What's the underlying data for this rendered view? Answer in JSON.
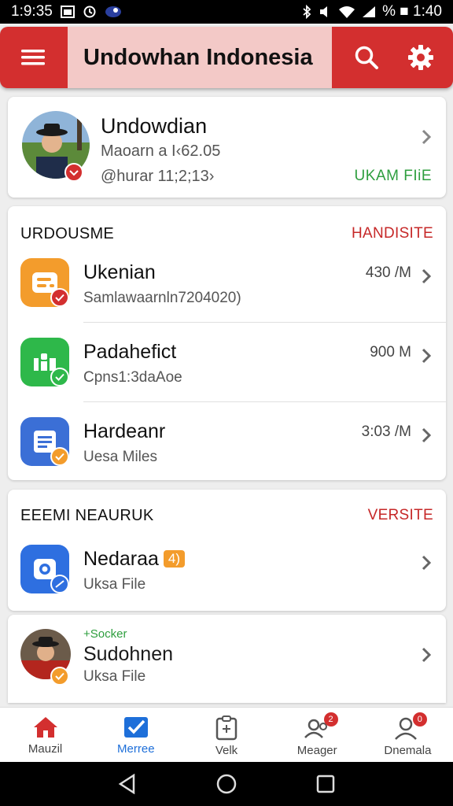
{
  "status_bar": {
    "time": "1:9:35",
    "right_text": "% ■ 1:40"
  },
  "app_bar": {
    "title": "Undowhan Indonesia"
  },
  "profile": {
    "name": "Undowdian",
    "line1": "Maoarn a I‹62.05",
    "line2": "@hurar 11;2;13›",
    "action": "UKAM FIiE"
  },
  "section1": {
    "heading": "URDOUSME",
    "link": "HANDISITE",
    "items": [
      {
        "title": "Ukenian",
        "subtitle": "Samlawaarnln7204020)",
        "size": "430 /M",
        "icon_color": "#f39c2c",
        "badge_color": "#d32f2f"
      },
      {
        "title": "Padahefict",
        "subtitle": "Cpns1:3daAoe",
        "size": "900 M",
        "icon_color": "#2eb84a",
        "badge_color": "#2eb84a"
      },
      {
        "title": "Hardeanr",
        "subtitle": "Uesa Miles",
        "size": "3:03 /M",
        "icon_color": "#3b6fd6",
        "badge_color": "#f39c2c"
      }
    ]
  },
  "section2": {
    "heading": "EEEMI NEAURUK",
    "link": "VERSITE",
    "items": [
      {
        "title": "Nedaraa",
        "tag": "4)",
        "subtitle": "Uksa File",
        "icon_color": "#2e6fe0",
        "badge_color": "#2e6fe0"
      }
    ]
  },
  "section3": {
    "label": "+Socker",
    "title": "Sudohnen",
    "subtitle": "Uksa File"
  },
  "bottom_nav": [
    {
      "label": "Mauzil",
      "icon": "home-icon",
      "color": "#d32f2f"
    },
    {
      "label": "Merree",
      "icon": "check-icon",
      "color": "#1e6fd9"
    },
    {
      "label": "Velk",
      "icon": "clipboard-icon",
      "color": "#555"
    },
    {
      "label": "Meager",
      "icon": "people-icon",
      "color": "#555",
      "badge": "2"
    },
    {
      "label": "Dnemala",
      "icon": "person-icon",
      "color": "#555",
      "badge": "0"
    }
  ],
  "colors": {
    "primary": "#d32f2f",
    "title_bg": "#f3c9c7",
    "accent_green": "#2e9e3e"
  }
}
